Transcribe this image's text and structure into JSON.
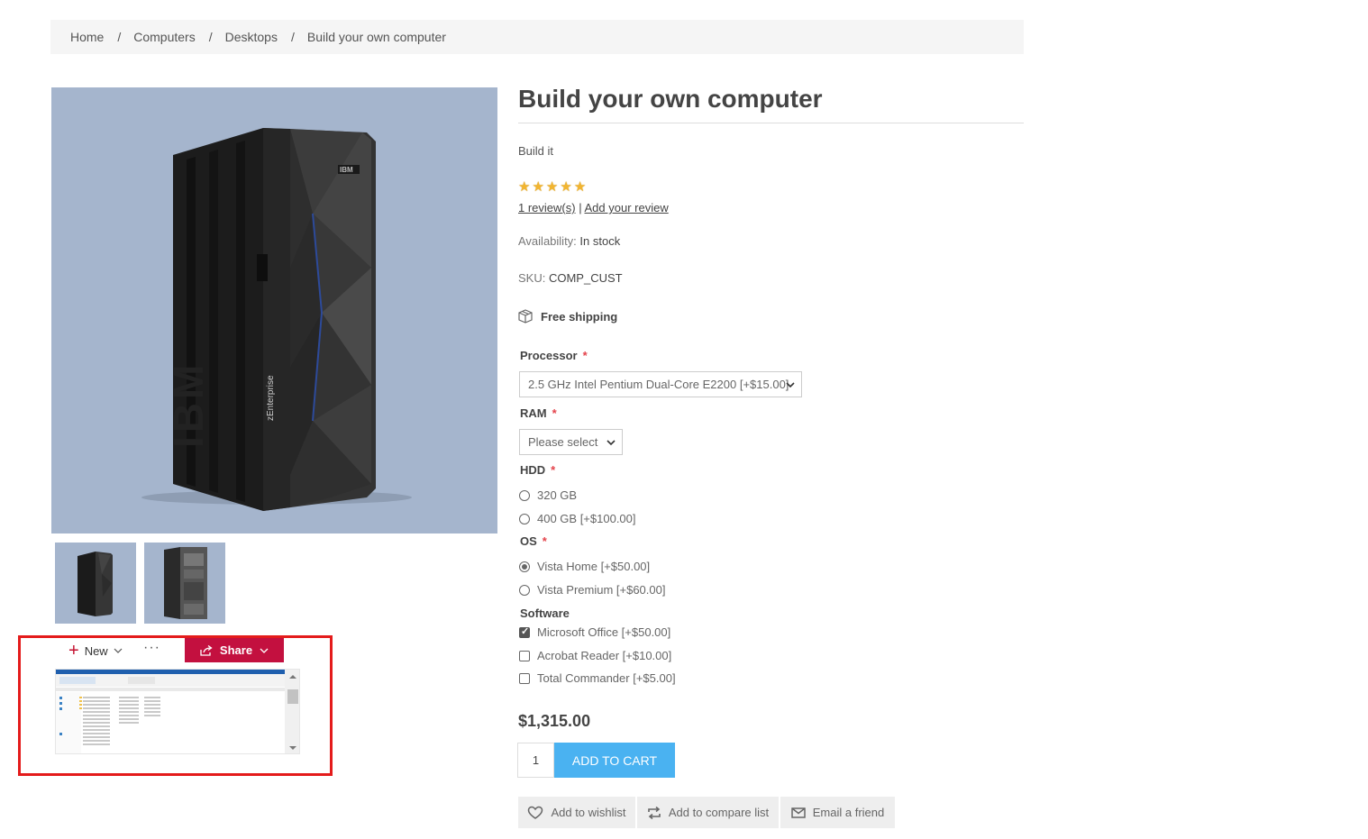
{
  "breadcrumb": {
    "items": [
      "Home",
      "Computers",
      "Desktops",
      "Build your own computer"
    ],
    "separator": "/"
  },
  "product": {
    "title": "Build your own computer",
    "short_description": "Build it",
    "rating_stars": 5,
    "reviews_link": "1 review(s)",
    "reviews_separator": "|",
    "add_review_link": "Add your review",
    "availability_label": "Availability:",
    "availability_value": "In stock",
    "sku_label": "SKU:",
    "sku_value": "COMP_CUST",
    "shipping": "Free shipping",
    "price": "$1,315.00",
    "quantity": "1",
    "add_to_cart": "Add to cart"
  },
  "attributes": {
    "processor_label": "Processor",
    "processor_value": "2.5 GHz Intel Pentium Dual-Core E2200 [+$15.00]",
    "ram_label": "RAM",
    "ram_value": "Please select",
    "hdd_label": "HDD",
    "hdd_options": [
      "320 GB",
      "400 GB [+$100.00]"
    ],
    "os_label": "OS",
    "os_options": [
      "Vista Home [+$50.00]",
      "Vista Premium [+$60.00]"
    ],
    "os_selected": 0,
    "software_label": "Software",
    "software_options": [
      "Microsoft Office [+$50.00]",
      "Acrobat Reader [+$10.00]",
      "Total Commander [+$5.00]"
    ],
    "software_checked": [
      true,
      false,
      false
    ],
    "required_mark": "*"
  },
  "actions": {
    "wishlist": "Add to wishlist",
    "compare": "Add to compare list",
    "email": "Email a friend"
  },
  "overlay": {
    "new_label": "New",
    "share_label": "Share"
  },
  "colors": {
    "add_to_cart": "#4ab2f1",
    "share_button": "#c3103f",
    "highlight_border": "#e41b1b",
    "image_background": "#a5b5cd",
    "star": "#f2b530"
  }
}
